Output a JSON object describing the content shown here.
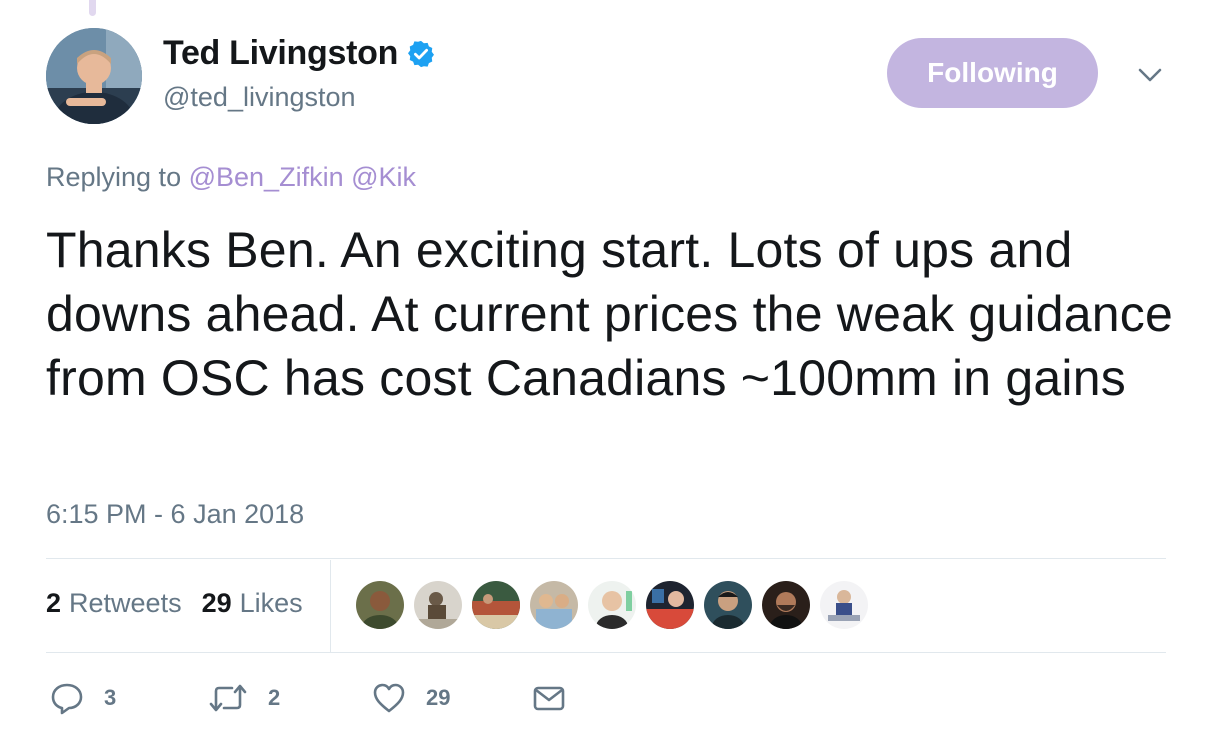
{
  "author": {
    "display_name": "Ted Livingston",
    "handle": "@ted_livingston",
    "verified_icon": "verified-badge-icon"
  },
  "follow_button": {
    "label": "Following"
  },
  "replying": {
    "prefix": "Replying to",
    "mentions": [
      "@Ben_Zifkin",
      "@Kik"
    ]
  },
  "tweet": {
    "text": "Thanks Ben. An exciting start. Lots of ups and downs ahead. At current prices the weak guidance from OSC has cost Canadians ~100mm in gains",
    "timestamp": "6:15 PM - 6 Jan 2018"
  },
  "stats": {
    "retweets_count": "2",
    "retweets_label": "Retweets",
    "likes_count": "29",
    "likes_label": "Likes"
  },
  "actions": {
    "reply_count": "3",
    "retweet_count": "2",
    "like_count": "29"
  },
  "colors": {
    "accent_light": "#c3b5e0",
    "mention": "#a58ed2",
    "muted": "#657786",
    "text": "#14171a",
    "verified": "#1da1f2"
  }
}
